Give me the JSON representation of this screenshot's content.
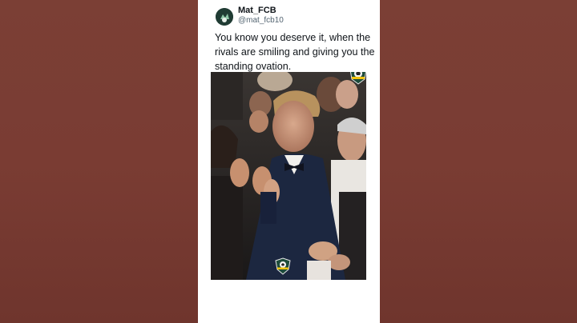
{
  "post": {
    "display_name": "Mat_FCB",
    "handle": "@mat_fcb10",
    "text": "You know you deserve it, when the rivals are smiling and giving you the standing ovation."
  },
  "media": {
    "type": "photo",
    "watermark_icon": "football-shield-logo-icon"
  },
  "colors": {
    "page_background": "#7a3e34",
    "card_background": "#ffffff",
    "text_primary": "#0f1419",
    "text_secondary": "#536471"
  }
}
